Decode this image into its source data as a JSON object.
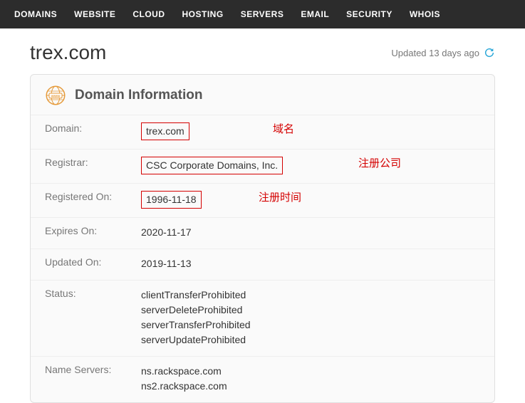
{
  "nav": {
    "items": [
      "DOMAINS",
      "WEBSITE",
      "CLOUD",
      "HOSTING",
      "SERVERS",
      "EMAIL",
      "SECURITY",
      "WHOIS"
    ]
  },
  "hero": {
    "domain": "trex.com",
    "updated": "Updated 13 days ago"
  },
  "card": {
    "title": "Domain Information"
  },
  "info": {
    "domain_label": "Domain:",
    "domain_value": "trex.com",
    "registrar_label": "Registrar:",
    "registrar_value": "CSC Corporate Domains, Inc.",
    "registered_on_label": "Registered On:",
    "registered_on_value": "1996-11-18",
    "expires_on_label": "Expires On:",
    "expires_on_value": "2020-11-17",
    "updated_on_label": "Updated On:",
    "updated_on_value": "2019-11-13",
    "status_label": "Status:",
    "status_values": [
      "clientTransferProhibited",
      "serverDeleteProhibited",
      "serverTransferProhibited",
      "serverUpdateProhibited"
    ],
    "ns_label": "Name Servers:",
    "ns_values": [
      "ns.rackspace.com",
      "ns2.rackspace.com"
    ]
  },
  "annotations": {
    "domain": "域名",
    "registrar": "注册公司",
    "registered_on": "注册时间"
  },
  "colors": {
    "annotation": "#d40000",
    "nav_bg": "#2c2c2c"
  }
}
